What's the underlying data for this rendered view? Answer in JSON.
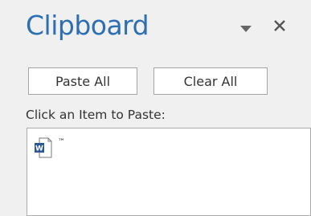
{
  "pane": {
    "title": "Clipboard"
  },
  "buttons": {
    "paste_all": "Paste All",
    "clear_all": "Clear All"
  },
  "instructions": "Click an Item to Paste:",
  "items": [
    {
      "icon": "word-document-icon",
      "text": "™"
    }
  ],
  "colors": {
    "title": "#2e6fb2",
    "word_blue": "#2b579a",
    "background": "#f0f0f0"
  },
  "icons": {
    "menu": "dropdown-arrow-icon",
    "close": "close-icon"
  }
}
